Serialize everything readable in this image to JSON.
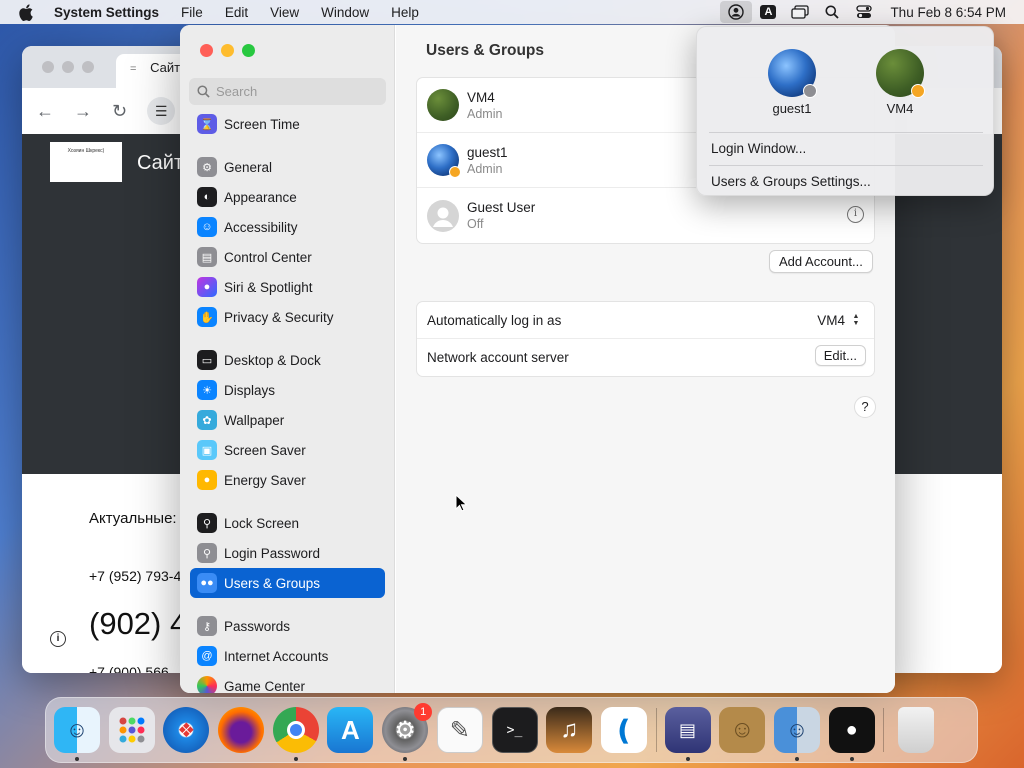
{
  "menubar": {
    "app_name": "System Settings",
    "menus": [
      "File",
      "Edit",
      "View",
      "Window",
      "Help"
    ],
    "status_icons": [
      "user-icon",
      "input-source-icon",
      "screen-mirroring-icon",
      "spotlight-icon",
      "control-center-icon"
    ],
    "input_source_label": "A",
    "clock": "Thu Feb 8  6:54 PM"
  },
  "browser": {
    "tab_title": "Сайт",
    "logo_text": "Хозяин Шкрекс)",
    "site_title": "Сайт",
    "actual_label": "Актуальные:",
    "phone1": "+7 (952) 793-4",
    "phone_big": "(902) 4",
    "phone3": "+7 (900) 566"
  },
  "settings": {
    "search_placeholder": "Search",
    "sidebar": [
      {
        "label": "Screen Time",
        "icon": "hourglass-icon",
        "color": "#5e5ce6"
      },
      {
        "label": "General",
        "icon": "gear-icon",
        "color": "#8e8e93"
      },
      {
        "label": "Appearance",
        "icon": "appearance-icon",
        "color": "#1d1d1f"
      },
      {
        "label": "Accessibility",
        "icon": "accessibility-icon",
        "color": "#0a84ff"
      },
      {
        "label": "Control Center",
        "icon": "control-center-icon",
        "color": "#8e8e93"
      },
      {
        "label": "Siri & Spotlight",
        "icon": "siri-icon",
        "color": "#c135e0"
      },
      {
        "label": "Privacy & Security",
        "icon": "hand-icon",
        "color": "#0a84ff"
      },
      {
        "label": "Desktop & Dock",
        "icon": "dock-icon",
        "color": "#1d1d1f"
      },
      {
        "label": "Displays",
        "icon": "sun-icon",
        "color": "#0a84ff"
      },
      {
        "label": "Wallpaper",
        "icon": "flower-icon",
        "color": "#35aadc"
      },
      {
        "label": "Screen Saver",
        "icon": "screensaver-icon",
        "color": "#5ac8fa"
      },
      {
        "label": "Energy Saver",
        "icon": "bulb-icon",
        "color": "#ffb800"
      },
      {
        "label": "Lock Screen",
        "icon": "lock-icon",
        "color": "#1d1d1f"
      },
      {
        "label": "Login Password",
        "icon": "lock-icon",
        "color": "#8e8e93"
      },
      {
        "label": "Users & Groups",
        "icon": "users-icon",
        "color": "#0a84ff"
      },
      {
        "label": "Passwords",
        "icon": "key-icon",
        "color": "#8e8e93"
      },
      {
        "label": "Internet Accounts",
        "icon": "at-icon",
        "color": "#0a84ff"
      },
      {
        "label": "Game Center",
        "icon": "game-center-icon",
        "color": "#ff9500"
      }
    ],
    "main_title": "Users & Groups",
    "users": [
      {
        "name": "VM4",
        "role": "Admin"
      },
      {
        "name": "guest1",
        "role": "Admin"
      },
      {
        "name": "Guest User",
        "role": "Off"
      }
    ],
    "add_account": "Add Account...",
    "auto_login_label": "Automatically log in as",
    "auto_login_value": "VM4",
    "network_server_label": "Network account server",
    "edit_button": "Edit...",
    "help_label": "?"
  },
  "dropdown": {
    "users": [
      "guest1",
      "VM4"
    ],
    "items": [
      "Login Window...",
      "Users & Groups Settings..."
    ]
  },
  "dock": {
    "apps": [
      "Finder",
      "Launchpad",
      "Safari",
      "Firefox",
      "Chrome",
      "App Store",
      "System Settings",
      "TextEdit",
      "Terminal",
      "GarageBand",
      "Visual Studio Code",
      "Remote Desktop",
      "Contacts",
      "Migration Assistant",
      "Bartender",
      "Trash"
    ],
    "settings_badge": "1"
  }
}
